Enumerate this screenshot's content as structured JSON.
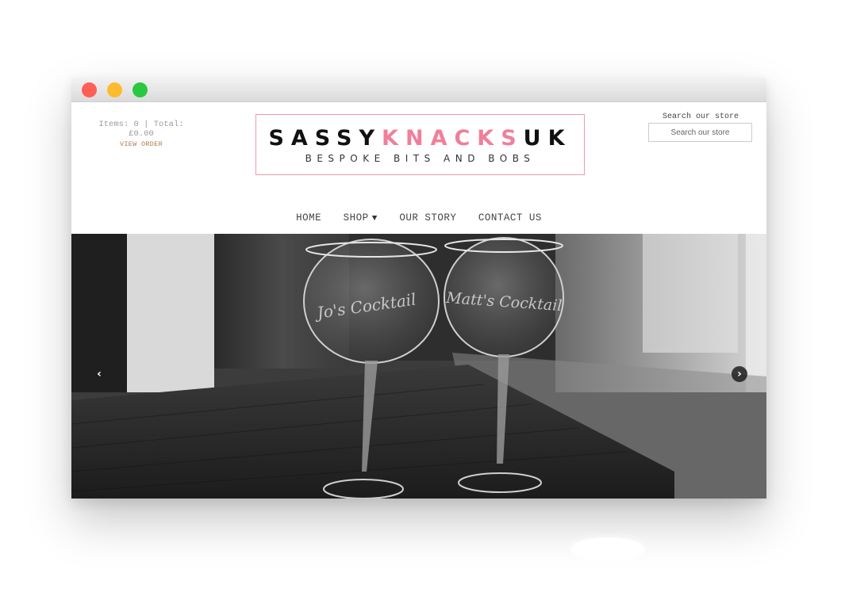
{
  "cart": {
    "summary": "Items: 0 | Total: £0.00",
    "view_order": "VIEW ORDER"
  },
  "logo": {
    "part1": "SASSY",
    "part2": "KNACKS",
    "part3": "UK",
    "tagline": "BESPOKE BITS AND BOBS",
    "colors": {
      "dark": "#111111",
      "pink": "#f07f9b",
      "border": "#f09aa8"
    }
  },
  "search": {
    "label": "Search our store",
    "placeholder": "Search our store"
  },
  "nav": {
    "home": "HOME",
    "shop": "SHOP",
    "our_story": "OUR STORY",
    "contact_us": "CONTACT US"
  },
  "slider": {
    "glass_left_text": "Jo's Cocktail",
    "glass_right_text": "Matt's Cocktail"
  },
  "icons": {
    "prev": "chevron-left-icon",
    "next": "chevron-right-icon",
    "dropdown": "caret-down-icon"
  }
}
